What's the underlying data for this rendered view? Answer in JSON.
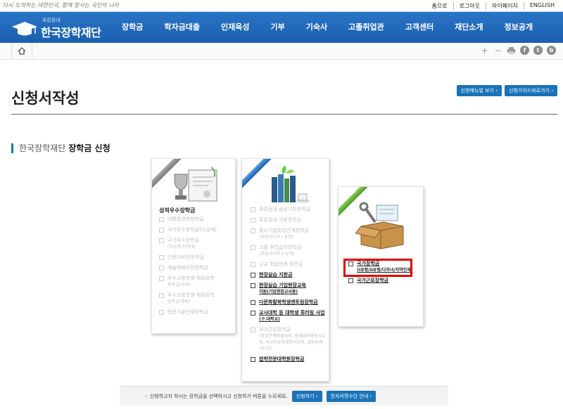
{
  "topbar": {
    "slogan": "다시 도약하는 대한민국, 함께 잘사는 국민의 나라",
    "links": [
      "홈으로",
      "로그아웃",
      "마이페이지",
      "ENGLISH"
    ]
  },
  "logo": {
    "sub": "푸른등대",
    "name": "한국장학재단"
  },
  "menu": [
    "장학금",
    "학자금대출",
    "인재육성",
    "기부",
    "기숙사",
    "고졸취업관",
    "고객센터",
    "재단소개",
    "정보공개"
  ],
  "utility": {
    "home_icon": "home-icon",
    "icons": [
      {
        "name": "zoom-in-icon",
        "glyph": "+"
      },
      {
        "name": "zoom-out-icon",
        "glyph": "−"
      },
      {
        "name": "print-icon",
        "glyph": "▬"
      },
      {
        "name": "facebook-icon",
        "glyph": "f"
      },
      {
        "name": "twitter-icon",
        "glyph": "t"
      },
      {
        "name": "blog-icon",
        "glyph": "b"
      }
    ]
  },
  "page": {
    "title": "신청서작성",
    "buttons": [
      "신청매뉴얼 보기 ›",
      "신청가이드바로가기 ›"
    ]
  },
  "section": {
    "pre": "한국장학재단",
    "title": "장학금 신청"
  },
  "cards": [
    {
      "heading": "성적우수장학금",
      "items": [
        {
          "label": "대통령과학장학금",
          "sub": "",
          "enabled": false
        },
        {
          "label": "국가우수장학금(이공계)",
          "sub": "",
          "enabled": false
        },
        {
          "label": "국가우수장학금",
          "sub": "(이공계,지역대)",
          "enabled": false
        },
        {
          "label": "인문100년장학금",
          "sub": "",
          "enabled": false
        },
        {
          "label": "예술체육비전장학금",
          "sub": "",
          "enabled": false
        },
        {
          "label": "우수고등학생 해외유학",
          "sub": "장학금(국내)",
          "enabled": false
        },
        {
          "label": "우수고등학생 해외유학",
          "sub": "장학금(해외)",
          "enabled": false
        },
        {
          "label": "전문기술인재장학금",
          "sub": "",
          "enabled": false
        }
      ]
    },
    {
      "heading": "",
      "items": [
        {
          "label": "푸른등대 삼성기부장학금",
          "sub": "",
          "enabled": false
        },
        {
          "label": "푸른등대 기부장학금",
          "sub": "",
          "enabled": false
        },
        {
          "label": "중소기업취업연계장학금",
          "sub": "(희망사다리 I 유형)",
          "enabled": false
        },
        {
          "label": "고졸 후학습자장학금",
          "sub": "(희망사다리 II 유형)",
          "enabled": false
        },
        {
          "label": "고교 취업연계 장려금",
          "sub": "",
          "enabled": false
        },
        {
          "label": "현장실습 지원금",
          "sub": "",
          "enabled": true
        },
        {
          "label": "현장실습 기업현장교육",
          "sub": "지원(기업현장교사용)",
          "enabled": true
        },
        {
          "label": "다문화탈북학생멘토링장학금",
          "sub": "",
          "enabled": true
        },
        {
          "label": "교사대학 등 대학생 튜터링 사업",
          "sub": "(구.대학교)",
          "enabled": true
        },
        {
          "label": "국가근로장학금",
          "sub": "(취업연계중점대학, 장애대학생봉사유형, 외국인유학생봉사유형, 일반유형(추가))",
          "enabled": false
        },
        {
          "label": "법학전문대학원장학금",
          "sub": "",
          "enabled": true
        }
      ]
    },
    {
      "heading": "",
      "items": [
        {
          "label": "국가장학금",
          "sub": "(I유형/II유형/다자녀/지역인재)",
          "enabled": true
        },
        {
          "label": "국가근로장학금",
          "sub": "",
          "enabled": true
        }
      ]
    }
  ],
  "footer": {
    "text": "신청하고자 하시는 장학금을 선택하시고 신청하기 버튼을 누르세요.",
    "buttons": [
      "신청하기 ›",
      "전자서명수단 안내 ›"
    ]
  },
  "colors": {
    "brand": "#1b5fae",
    "button": "#1a73b8",
    "highlight": "#e60000"
  }
}
